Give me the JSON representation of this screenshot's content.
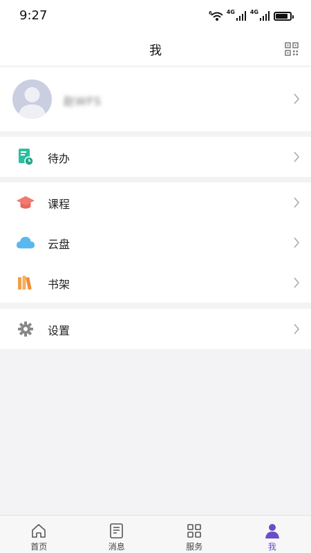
{
  "status_bar": {
    "time": "9:27",
    "network_1": "4G",
    "network_2": "4G",
    "wifi_badge": "6",
    "battery_level": 0.85
  },
  "header": {
    "title": "我"
  },
  "profile": {
    "username": "赵WFS"
  },
  "menu": {
    "todo": "待办",
    "course": "课程",
    "cloud": "云盘",
    "bookshelf": "书架",
    "settings": "设置"
  },
  "tabs": [
    {
      "label": "首页",
      "icon": "home-icon"
    },
    {
      "label": "消息",
      "icon": "message-icon"
    },
    {
      "label": "服务",
      "icon": "grid-icon"
    },
    {
      "label": "我",
      "icon": "person-icon"
    }
  ],
  "colors": {
    "accent": "#6b4ec6",
    "todo": "#2bbf9f",
    "course": "#f07a70",
    "cloud": "#5ab8f0",
    "bookshelf": "#f29f4a",
    "settings": "#888888"
  }
}
